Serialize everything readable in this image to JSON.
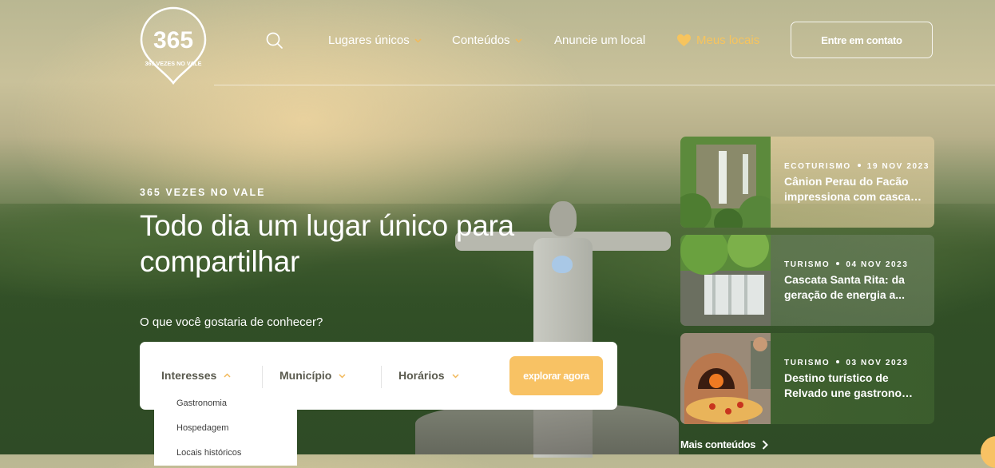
{
  "brand": {
    "logo_number": "365",
    "logo_text": "365 VEZES NO VALE"
  },
  "nav": {
    "search_icon": "search-icon",
    "items": [
      {
        "label": "Lugares únicos",
        "has_dropdown": true
      },
      {
        "label": "Conteúdos",
        "has_dropdown": true
      },
      {
        "label": "Anuncie um local",
        "has_dropdown": false
      }
    ],
    "favorites": {
      "label": "Meus locais",
      "icon": "heart-icon"
    },
    "contact_button": "Entre em contato"
  },
  "hero": {
    "eyebrow": "365 VEZES NO VALE",
    "title": "Todo dia um lugar único para compartilhar",
    "question": "O que você gostaria de conhecer?"
  },
  "search": {
    "filters": [
      {
        "label": "Interesses",
        "state": "open"
      },
      {
        "label": "Município",
        "state": "closed"
      },
      {
        "label": "Horários",
        "state": "closed"
      }
    ],
    "submit_label": "explorar agora",
    "dropdown_options": [
      "Gastronomia",
      "Hospedagem",
      "Locais históricos"
    ]
  },
  "articles": [
    {
      "category": "ECOTURISMO",
      "date": "19 NOV 2023",
      "title_line1": "Cânion Perau do Facão",
      "title_line2": "impressiona com cascat..."
    },
    {
      "category": "TURISMO",
      "date": "04 NOV 2023",
      "title_line1": "Cascata Santa Rita: da",
      "title_line2": "geração de energia a..."
    },
    {
      "category": "TURISMO",
      "date": "03 NOV 2023",
      "title_line1": "Destino turístico de",
      "title_line2": "Relvado une gastronomi..."
    }
  ],
  "more_link": "Mais conteúdos",
  "colors": {
    "accent": "#f8c264",
    "favorites": "#f6c45e",
    "filter_text": "#5a5a4e"
  }
}
